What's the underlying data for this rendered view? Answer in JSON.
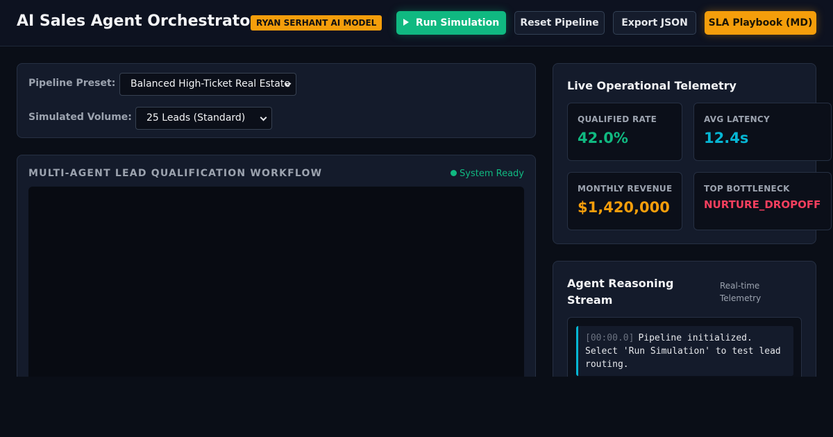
{
  "header": {
    "title": "AI Sales Agent Orchestrator",
    "badge": "RYAN SERHANT AI MODEL",
    "buttons": {
      "run": "Run Simulation",
      "reset": "Reset Pipeline",
      "export": "Export JSON",
      "sla": "SLA Playbook (MD)"
    }
  },
  "config": {
    "preset_label": "Pipeline Preset:",
    "preset_value": "Balanced High-Ticket Real Estate",
    "volume_label": "Simulated Volume:",
    "volume_value": "25 Leads (Standard)"
  },
  "workflow": {
    "title": "MULTI-AGENT LEAD QUALIFICATION WORKFLOW",
    "status": "System Ready"
  },
  "telemetry": {
    "title": "Live Operational Telemetry",
    "metrics": [
      {
        "label": "QUALIFIED RATE",
        "value": "42.0%",
        "color": "#10b981"
      },
      {
        "label": "AVG LATENCY",
        "value": "12.4s",
        "color": "#06b6d4"
      },
      {
        "label": "MONTHLY REVENUE",
        "value": "$1,420,000",
        "color": "#f59e0b"
      },
      {
        "label": "TOP BOTTLENECK",
        "value": "NURTURE_DROPOFF",
        "color": "#f43f5e"
      }
    ]
  },
  "reasoning": {
    "title": "Agent Reasoning Stream",
    "subtitle": "Real-time Telemetry",
    "entries": [
      {
        "timestamp": "[00:00.0]",
        "message": "Pipeline initialized. Select 'Run Simulation' to test lead routing."
      }
    ]
  }
}
